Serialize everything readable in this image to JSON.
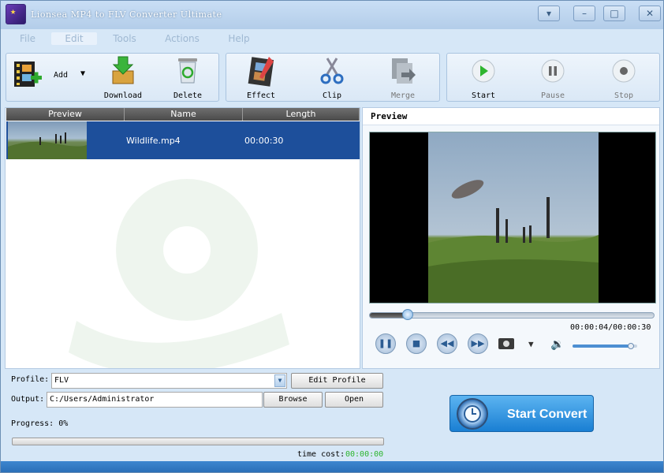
{
  "window": {
    "title": "Lionsea MP4 to FLV Converter Ultimate"
  },
  "menu": {
    "items": [
      "File",
      "Edit",
      "Tools",
      "Actions",
      "Help"
    ],
    "active": "Edit"
  },
  "toolbar": {
    "add_label": "Add",
    "download_label": "Download",
    "delete_label": "Delete",
    "effect_label": "Effect",
    "clip_label": "Clip",
    "merge_label": "Merge",
    "start_label": "Start",
    "pause_label": "Pause",
    "stop_label": "Stop"
  },
  "file_list": {
    "columns": [
      "Preview",
      "Name",
      "Length"
    ],
    "rows": [
      {
        "name": "Wildlife.mp4",
        "length": "00:00:30"
      }
    ]
  },
  "preview": {
    "header": "Preview",
    "time_display": "00:00:04/00:00:30",
    "position_fraction": 0.133,
    "volume_fraction": 0.9
  },
  "settings": {
    "profile_label": "Profile:",
    "profile_value": "FLV",
    "edit_profile_label": "Edit Profile",
    "output_label": "Output:",
    "output_value": "C:/Users/Administrator",
    "browse_label": "Browse",
    "open_label": "Open",
    "progress_text": "Progress: 0%",
    "progress_fraction": 0,
    "time_cost_label": "time cost:",
    "time_cost_value": "00:00:00"
  },
  "convert": {
    "label": "Start Convert"
  },
  "colors": {
    "accent": "#1a7fd3",
    "selection": "#1d4f9b",
    "time_cost": "#2db52d"
  }
}
